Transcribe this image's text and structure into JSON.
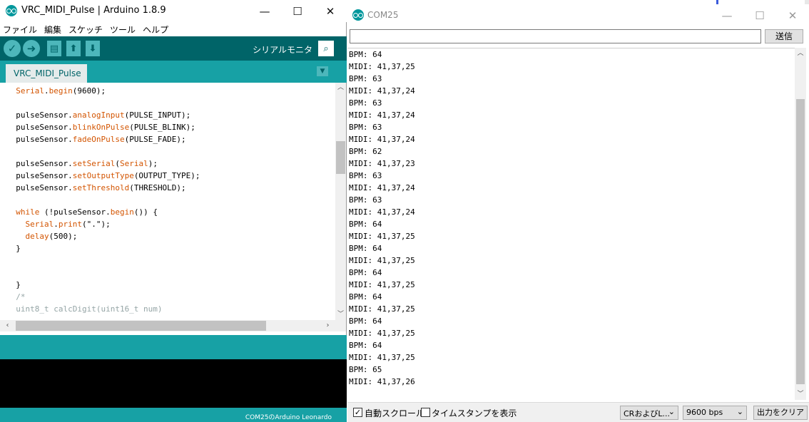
{
  "ide": {
    "title": "VRC_MIDI_Pulse | Arduino 1.8.9",
    "menu": [
      "ファイル",
      "編集",
      "スケッチ",
      "ツール",
      "ヘルプ"
    ],
    "toolbar": {
      "verify_icon": "check-icon",
      "upload_icon": "arrow-right-icon",
      "new_icon": "new-file-icon",
      "open_icon": "arrow-up-icon",
      "save_icon": "arrow-down-icon",
      "serial_monitor_label": "シリアルモニタ"
    },
    "tab": "VRC_MIDI_Pulse",
    "code_lines": [
      "Serial.begin(9600);",
      "",
      "pulseSensor.analogInput(PULSE_INPUT);",
      "pulseSensor.blinkOnPulse(PULSE_BLINK);",
      "pulseSensor.fadeOnPulse(PULSE_FADE);",
      "",
      "pulseSensor.setSerial(Serial);",
      "pulseSensor.setOutputType(OUTPUT_TYPE);",
      "pulseSensor.setThreshold(THRESHOLD);",
      "",
      "while (!pulseSensor.begin()) {",
      "  Serial.print(\".\");",
      "  delay(500);",
      "}",
      "",
      "",
      "}",
      "/*",
      "uint8_t calcDigit(uint16_t num)"
    ],
    "footer": "COM25のArduino Leonardo",
    "colors": {
      "toolbar": "#006468",
      "tabbar": "#17a1a5",
      "keyword": "#d35400"
    }
  },
  "serial": {
    "title": "COM25",
    "input_value": "",
    "send_label": "送信",
    "lines": [
      "BPM: 64",
      "MIDI: 41,37,25",
      "BPM: 63",
      "MIDI: 41,37,24",
      "BPM: 63",
      "MIDI: 41,37,24",
      "BPM: 63",
      "MIDI: 41,37,24",
      "BPM: 62",
      "MIDI: 41,37,23",
      "BPM: 63",
      "MIDI: 41,37,24",
      "BPM: 63",
      "MIDI: 41,37,24",
      "BPM: 64",
      "MIDI: 41,37,25",
      "BPM: 64",
      "MIDI: 41,37,25",
      "BPM: 64",
      "MIDI: 41,37,25",
      "BPM: 64",
      "MIDI: 41,37,25",
      "BPM: 64",
      "MIDI: 41,37,25",
      "BPM: 64",
      "MIDI: 41,37,25",
      "BPM: 65",
      "MIDI: 41,37,26"
    ],
    "autoscroll": {
      "label": "自動スクロール",
      "checked": true
    },
    "timestamp": {
      "label": "タイムスタンプを表示",
      "checked": false
    },
    "line_ending": "CRおよびL...",
    "baud": "9600 bps",
    "clear_label": "出力をクリア"
  }
}
